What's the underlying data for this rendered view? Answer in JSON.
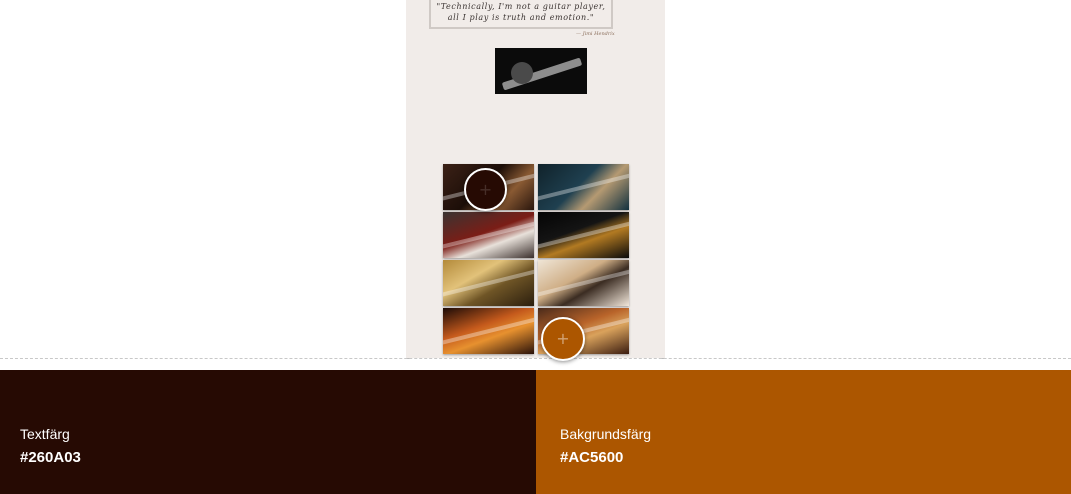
{
  "preview": {
    "quote_line1": "\"Technically, I'm not a guitar player,",
    "quote_line2": "all I play is truth and emotion.\"",
    "quote_author": "— Jimi Hendrix"
  },
  "swatches": [
    {
      "label": "Textfärg",
      "hex": "#260A03",
      "color": "#260A03"
    },
    {
      "label": "Bakgrundsfärg",
      "hex": "#AC5600",
      "color": "#AC5600"
    }
  ],
  "preview_background": "#F1ECE9",
  "icons": {
    "picker": "plus-icon"
  }
}
